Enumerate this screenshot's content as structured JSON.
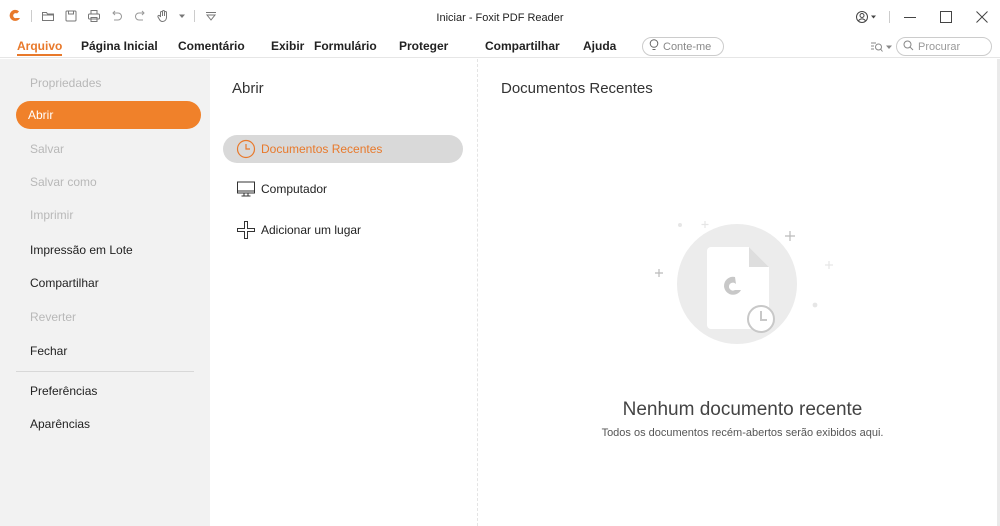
{
  "window": {
    "title": "Iniciar - Foxit PDF Reader"
  },
  "menu": {
    "tabs": [
      {
        "label": "Arquivo",
        "active": true
      },
      {
        "label": "Página Inicial"
      },
      {
        "label": "Comentário"
      },
      {
        "label": "Exibir"
      },
      {
        "label": "Formulário"
      },
      {
        "label": "Proteger"
      },
      {
        "label": "Compartilhar"
      },
      {
        "label": "Ajuda"
      }
    ],
    "tell_me_placeholder": "Conte-me",
    "search_placeholder": "Procurar"
  },
  "sidebar": {
    "items": [
      {
        "label": "Propriedades",
        "state": "disabled"
      },
      {
        "label": "Abrir",
        "state": "active"
      },
      {
        "label": "Salvar",
        "state": "disabled"
      },
      {
        "label": "Salvar como",
        "state": "disabled"
      },
      {
        "label": "Imprimir",
        "state": "disabled"
      },
      {
        "label": "Impressão em Lote",
        "state": "enabled"
      },
      {
        "label": "Compartilhar",
        "state": "enabled"
      },
      {
        "label": "Reverter",
        "state": "disabled"
      },
      {
        "label": "Fechar",
        "state": "enabled"
      },
      {
        "label": "Preferências",
        "state": "enabled"
      },
      {
        "label": "Aparências",
        "state": "enabled"
      }
    ]
  },
  "open_panel": {
    "title": "Abrir",
    "places": [
      {
        "label": "Documentos Recentes",
        "icon": "clock-icon",
        "selected": true
      },
      {
        "label": "Computador",
        "icon": "monitor-icon"
      },
      {
        "label": "Adicionar um lugar",
        "icon": "add-place-icon"
      }
    ]
  },
  "recent_panel": {
    "title": "Documentos Recentes",
    "empty_title": "Nenhum documento recente",
    "empty_subtitle": "Todos os documentos recém-abertos serão exibidos aqui."
  },
  "colors": {
    "accent": "#f0812a",
    "sidebar_bg": "#f2f2f2",
    "selected_place_bg": "#d9d9d9"
  }
}
